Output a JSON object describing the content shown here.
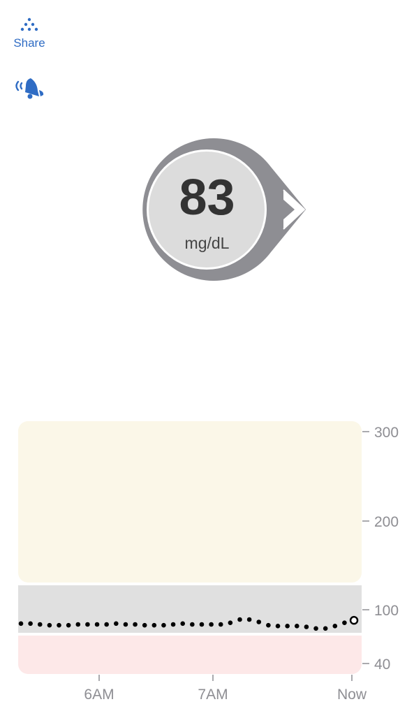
{
  "share": {
    "label": "Share",
    "icon": "share-dots-icon"
  },
  "alert": {
    "icon": "bell-alert-icon"
  },
  "reading": {
    "value": "83",
    "unit": "mg/dL",
    "trend": "steady",
    "trend_icon": "trend-arrow-icon"
  },
  "colors": {
    "accent": "#2f6cc4",
    "high_zone": "#fbf7e8",
    "target_zone": "#e0e0e0",
    "low_zone": "#fde8e8",
    "reading_ring": "#8e8e93"
  },
  "chart_data": {
    "type": "scatter",
    "title": "",
    "ylabel": "",
    "xlabel": "",
    "y_scale": "nonlinear",
    "y_ticks": [
      300,
      200,
      100,
      40
    ],
    "y_tick_labels": [
      "300",
      "200",
      "100",
      "40"
    ],
    "x_tick_labels": [
      "6AM",
      "7AM",
      "Now"
    ],
    "zones": {
      "low_below": 70,
      "target_range": [
        70,
        145
      ],
      "high_above": 145
    },
    "series": [
      {
        "values": [
          83,
          83,
          82,
          81,
          81,
          81,
          82,
          82,
          82,
          82,
          83,
          82,
          82,
          81,
          81,
          81,
          82,
          83,
          82,
          82,
          82,
          82,
          84,
          88,
          88,
          85,
          81,
          80,
          80,
          80,
          79,
          77,
          77,
          80,
          84,
          87
        ]
      }
    ],
    "current": {
      "value": 87
    }
  }
}
